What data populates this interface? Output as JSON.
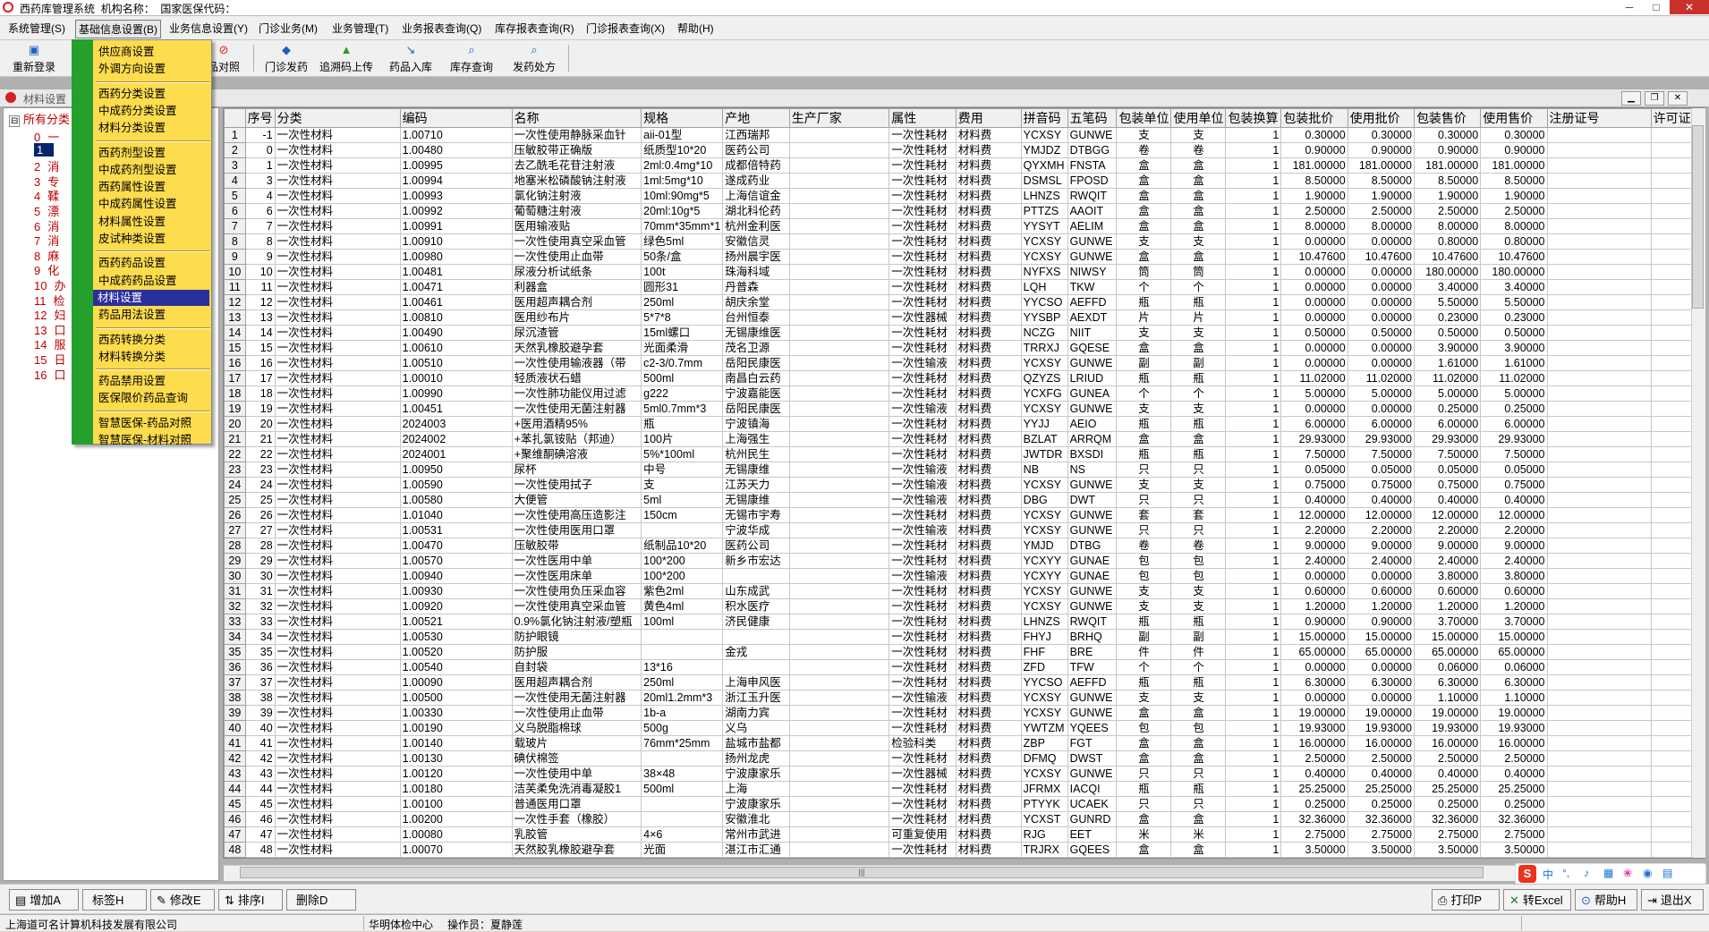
{
  "titlebar": {
    "app": "西药库管理系统",
    "org_label": "机构名称：",
    "code_label": "国家医保代码：",
    "min": "─",
    "max": "□",
    "close": "✕"
  },
  "menu": [
    "系统管理(S)",
    "基础信息设置(B)",
    "业务信息设置(Y)",
    "门诊业务(M)",
    "业务管理(T)",
    "业务报表查询(Q)",
    "库存报表查询(R)",
    "门诊报表查询(X)",
    "帮助(H)"
  ],
  "toolbar": {
    "relogin": "重新登录",
    "compare": "品对照",
    "outpatient": "门诊发药",
    "trace": "追溯码上传",
    "drugin": "药品入库",
    "stockq": "库存查询",
    "prescribe": "发药处方"
  },
  "child": {
    "title": "材料设置"
  },
  "dropdown": [
    {
      "label": "供应商设置"
    },
    {
      "label": "外调方向设置"
    },
    {
      "label": "西药分类设置"
    },
    {
      "label": "中成药分类设置"
    },
    {
      "label": "材料分类设置"
    },
    {
      "label": "西药剂型设置"
    },
    {
      "label": "中成药剂型设置"
    },
    {
      "label": "西药属性设置"
    },
    {
      "label": "中成药属性设置"
    },
    {
      "label": "材料属性设置"
    },
    {
      "label": "皮试种类设置"
    },
    {
      "label": "西药药品设置"
    },
    {
      "label": "中成药药品设置"
    },
    {
      "label": "材料设置"
    },
    {
      "label": "药品用法设置"
    },
    {
      "label": "西药转换分类"
    },
    {
      "label": "材料转换分类"
    },
    {
      "label": "药品禁用设置"
    },
    {
      "label": "医保限价药品查询"
    },
    {
      "label": "智慧医保-药品对照"
    },
    {
      "label": "智慧医保-材料对照"
    }
  ],
  "tree": {
    "root": "所有分类",
    "nodes": [
      "0",
      "1",
      "2",
      "3",
      "4",
      "5",
      "6",
      "7",
      "8",
      "9",
      "10",
      "11",
      "12",
      "13",
      "14",
      "15",
      "16"
    ],
    "glyphs": {
      "0": "一",
      "2": "消",
      "3": "专",
      "4": "鞣",
      "5": "漂",
      "6": "消",
      "7": "消",
      "8": "麻",
      "9": "化",
      "10": "办",
      "11": "检",
      "12": "妇",
      "13": "口",
      "14": "服",
      "15": "日",
      "16": "口"
    }
  },
  "grid": {
    "columns": [
      "序号",
      "分类",
      "编码",
      "名称",
      "规格",
      "产地",
      "生产厂家",
      "属性",
      "费用",
      "拼音码",
      "五笔码",
      "包装单位",
      "使用单位",
      "包装换算",
      "包装批价",
      "使用批价",
      "包装售价",
      "使用售价",
      "注册证号",
      "许可证"
    ],
    "rows": [
      [
        "1",
        "-1",
        "一次性材料",
        "1.00710",
        "一次性使用静脉采血针",
        "aii-01型",
        "江西瑞邦",
        "",
        "一次性耗材",
        "材料费",
        "YCXSY",
        "GUNWE",
        "支",
        "支",
        "1",
        "0.30000",
        "0.30000",
        "0.30000",
        "0.30000"
      ],
      [
        "2",
        "0",
        "一次性材料",
        "1.00480",
        "压敏胶带正确版",
        "纸质型10*20",
        "医药公司",
        "",
        "一次性耗材",
        "材料费",
        "YMJDZ",
        "DTBGG",
        "卷",
        "卷",
        "1",
        "0.90000",
        "0.90000",
        "0.90000",
        "0.90000"
      ],
      [
        "3",
        "1",
        "一次性材料",
        "1.00995",
        "去乙酰毛花苷注射液",
        "2ml:0.4mg*10",
        "成都倍特药",
        "",
        "一次性耗材",
        "材料费",
        "QYXMH",
        "FNSTA",
        "盒",
        "盒",
        "1",
        "181.00000",
        "181.00000",
        "181.00000",
        "181.00000"
      ],
      [
        "4",
        "3",
        "一次性材料",
        "1.00994",
        "地塞米松磷酸钠注射液",
        "1ml:5mg*10",
        "遂成药业",
        "",
        "一次性耗材",
        "材料费",
        "DSMSL",
        "FPOSD",
        "盒",
        "盒",
        "1",
        "8.50000",
        "8.50000",
        "8.50000",
        "8.50000"
      ],
      [
        "5",
        "4",
        "一次性材料",
        "1.00993",
        "氯化钠注射液",
        "10ml:90mg*5",
        "上海信谊金",
        "",
        "一次性耗材",
        "材料费",
        "LHNZS",
        "RWQIT",
        "盒",
        "盒",
        "1",
        "1.90000",
        "1.90000",
        "1.90000",
        "1.90000"
      ],
      [
        "6",
        "6",
        "一次性材料",
        "1.00992",
        "葡萄糖注射液",
        "20ml:10g*5",
        "湖北科伦药",
        "",
        "一次性耗材",
        "材料费",
        "PTTZS",
        "AAOIT",
        "盒",
        "盒",
        "1",
        "2.50000",
        "2.50000",
        "2.50000",
        "2.50000"
      ],
      [
        "7",
        "7",
        "一次性材料",
        "1.00991",
        "医用输液贴",
        "70mm*35mm*1",
        "杭州金利医",
        "",
        "一次性耗材",
        "材料费",
        "YYSYT",
        "AELIM",
        "盒",
        "盒",
        "1",
        "8.00000",
        "8.00000",
        "8.00000",
        "8.00000"
      ],
      [
        "8",
        "8",
        "一次性材料",
        "1.00910",
        "一次性使用真空采血管",
        "绿色5ml",
        "安徽信灵",
        "",
        "一次性耗材",
        "材料费",
        "YCXSY",
        "GUNWE",
        "支",
        "支",
        "1",
        "0.00000",
        "0.00000",
        "0.80000",
        "0.80000"
      ],
      [
        "9",
        "9",
        "一次性材料",
        "1.00980",
        "一次性使用止血带",
        "50条/盒",
        "扬州晨宇医",
        "",
        "一次性耗材",
        "材料费",
        "YCXSY",
        "GUNWE",
        "盒",
        "盒",
        "1",
        "10.47600",
        "10.47600",
        "10.47600",
        "10.47600"
      ],
      [
        "10",
        "10",
        "一次性材料",
        "1.00481",
        "尿液分析试纸条",
        "100t",
        "珠海科域",
        "",
        "一次性耗材",
        "材料费",
        "NYFXS",
        "NIWSY",
        "筒",
        "筒",
        "1",
        "0.00000",
        "0.00000",
        "180.00000",
        "180.00000"
      ],
      [
        "11",
        "11",
        "一次性材料",
        "1.00471",
        "利器盒",
        "圆形31",
        "丹普森",
        "",
        "一次性耗材",
        "材料费",
        "LQH",
        "TKW",
        "个",
        "个",
        "1",
        "0.00000",
        "0.00000",
        "3.40000",
        "3.40000"
      ],
      [
        "12",
        "12",
        "一次性材料",
        "1.00461",
        "医用超声耦合剂",
        "250ml",
        "胡庆余堂",
        "",
        "一次性耗材",
        "材料费",
        "YYCSO",
        "AEFFD",
        "瓶",
        "瓶",
        "1",
        "0.00000",
        "0.00000",
        "5.50000",
        "5.50000"
      ],
      [
        "13",
        "13",
        "一次性材料",
        "1.00810",
        "医用纱布片",
        "5*7*8",
        "台州恒泰",
        "",
        "一次性器械",
        "材料费",
        "YYSBP",
        "AEXDT",
        "片",
        "片",
        "1",
        "0.00000",
        "0.00000",
        "0.23000",
        "0.23000"
      ],
      [
        "14",
        "14",
        "一次性材料",
        "1.00490",
        "尿沉渣管",
        "15ml螺口",
        "无锡康维医",
        "",
        "一次性耗材",
        "材料费",
        "NCZG",
        "NIIT",
        "支",
        "支",
        "1",
        "0.50000",
        "0.50000",
        "0.50000",
        "0.50000"
      ],
      [
        "15",
        "15",
        "一次性材料",
        "1.00610",
        "天然乳橡胶避孕套",
        "光面柔滑",
        "茂名卫源",
        "",
        "一次性耗材",
        "材料费",
        "TRRXJ",
        "GQESE",
        "盒",
        "盒",
        "1",
        "0.00000",
        "0.00000",
        "3.90000",
        "3.90000"
      ],
      [
        "16",
        "16",
        "一次性材料",
        "1.00510",
        "一次性使用输液器（带",
        "c2-3/0.7mm",
        "岳阳民康医",
        "",
        "一次性输液",
        "材料费",
        "YCXSY",
        "GUNWE",
        "副",
        "副",
        "1",
        "0.00000",
        "0.00000",
        "1.61000",
        "1.61000"
      ],
      [
        "17",
        "17",
        "一次性材料",
        "1.00010",
        "轻质液状石蜡",
        "500ml",
        "南昌白云药",
        "",
        "一次性耗材",
        "材料费",
        "QZYZS",
        "LRIUD",
        "瓶",
        "瓶",
        "1",
        "11.02000",
        "11.02000",
        "11.02000",
        "11.02000"
      ],
      [
        "18",
        "18",
        "一次性材料",
        "1.00990",
        "一次性肺功能仪用过滤",
        "g222",
        "宁波嘉能医",
        "",
        "一次性耗材",
        "材料费",
        "YCXFG",
        "GUNEA",
        "个",
        "个",
        "1",
        "5.00000",
        "5.00000",
        "5.00000",
        "5.00000"
      ],
      [
        "19",
        "19",
        "一次性材料",
        "1.00451",
        "一次性使用无菌注射器",
        "5ml0.7mm*3",
        "岳阳民康医",
        "",
        "一次性输液",
        "材料费",
        "YCXSY",
        "GUNWE",
        "支",
        "支",
        "1",
        "0.00000",
        "0.00000",
        "0.25000",
        "0.25000"
      ],
      [
        "20",
        "20",
        "一次性材料",
        "2024003",
        "+医用酒精95%",
        "瓶",
        "宁波镇海",
        "",
        "一次性耗材",
        "材料费",
        "YYJJ",
        "AEIO",
        "瓶",
        "瓶",
        "1",
        "6.00000",
        "6.00000",
        "6.00000",
        "6.00000"
      ],
      [
        "21",
        "21",
        "一次性材料",
        "2024002",
        "+苯扎氯铵贴（邦迪）",
        "100片",
        "上海强生",
        "",
        "一次性耗材",
        "材料费",
        "BZLAT",
        "ARRQM",
        "盒",
        "盒",
        "1",
        "29.93000",
        "29.93000",
        "29.93000",
        "29.93000"
      ],
      [
        "22",
        "22",
        "一次性材料",
        "2024001",
        "+聚维酮碘溶液",
        "5%*100ml",
        "杭州民生",
        "",
        "一次性耗材",
        "材料费",
        "JWTDR",
        "BXSDI",
        "瓶",
        "瓶",
        "1",
        "7.50000",
        "7.50000",
        "7.50000",
        "7.50000"
      ],
      [
        "23",
        "23",
        "一次性材料",
        "1.00950",
        "尿杯",
        "中号",
        "无锡康维",
        "",
        "一次性输液",
        "材料费",
        "NB",
        "NS",
        "只",
        "只",
        "1",
        "0.05000",
        "0.05000",
        "0.05000",
        "0.05000"
      ],
      [
        "24",
        "24",
        "一次性材料",
        "1.00590",
        "一次性使用拭子",
        "支",
        "江苏天力",
        "",
        "一次性输液",
        "材料费",
        "YCXSY",
        "GUNWE",
        "支",
        "支",
        "1",
        "0.75000",
        "0.75000",
        "0.75000",
        "0.75000"
      ],
      [
        "25",
        "25",
        "一次性材料",
        "1.00580",
        "大便管",
        "5ml",
        "无锡康维",
        "",
        "一次性输液",
        "材料费",
        "DBG",
        "DWT",
        "只",
        "只",
        "1",
        "0.40000",
        "0.40000",
        "0.40000",
        "0.40000"
      ],
      [
        "26",
        "26",
        "一次性材料",
        "1.01040",
        "一次性使用高压造影注",
        "150cm",
        "无锡市宇寿",
        "",
        "一次性耗材",
        "材料费",
        "YCXSY",
        "GUNWE",
        "套",
        "套",
        "1",
        "12.00000",
        "12.00000",
        "12.00000",
        "12.00000"
      ],
      [
        "27",
        "27",
        "一次性材料",
        "1.00531",
        "一次性使用医用口罩",
        "",
        "宁波华成",
        "",
        "一次性输液",
        "材料费",
        "YCXSY",
        "GUNWE",
        "只",
        "只",
        "1",
        "2.20000",
        "2.20000",
        "2.20000",
        "2.20000"
      ],
      [
        "28",
        "28",
        "一次性材料",
        "1.00470",
        "压敏胶带",
        "纸制品10*20",
        "医药公司",
        "",
        "一次性耗材",
        "材料费",
        "YMJD",
        "DTBG",
        "卷",
        "卷",
        "1",
        "9.00000",
        "9.00000",
        "9.00000",
        "9.00000"
      ],
      [
        "29",
        "29",
        "一次性材料",
        "1.00570",
        "一次性医用中单",
        "100*200",
        "新乡市宏达",
        "",
        "一次性耗材",
        "材料费",
        "YCXYY",
        "GUNAE",
        "包",
        "包",
        "1",
        "2.40000",
        "2.40000",
        "2.40000",
        "2.40000"
      ],
      [
        "30",
        "30",
        "一次性材料",
        "1.00940",
        "一次性医用床单",
        "100*200",
        "",
        "",
        "一次性输液",
        "材料费",
        "YCXYY",
        "GUNAE",
        "包",
        "包",
        "1",
        "0.00000",
        "0.00000",
        "3.80000",
        "3.80000"
      ],
      [
        "31",
        "31",
        "一次性材料",
        "1.00930",
        "一次性使用负压采血容",
        "紫色2ml",
        "山东成武",
        "",
        "一次性耗材",
        "材料费",
        "YCXSY",
        "GUNWE",
        "支",
        "支",
        "1",
        "0.60000",
        "0.60000",
        "0.60000",
        "0.60000"
      ],
      [
        "32",
        "32",
        "一次性材料",
        "1.00920",
        "一次性使用真空采血管",
        "黄色4ml",
        "积水医疗",
        "",
        "一次性耗材",
        "材料费",
        "YCXSY",
        "GUNWE",
        "支",
        "支",
        "1",
        "1.20000",
        "1.20000",
        "1.20000",
        "1.20000"
      ],
      [
        "33",
        "33",
        "一次性材料",
        "1.00521",
        "0.9%氯化钠注射液/塑瓶",
        "100ml",
        "济民健康",
        "",
        "一次性耗材",
        "材料费",
        "LHNZS",
        "RWQIT",
        "瓶",
        "瓶",
        "1",
        "0.90000",
        "0.90000",
        "3.70000",
        "3.70000"
      ],
      [
        "34",
        "34",
        "一次性材料",
        "1.00530",
        "防护眼镜",
        "",
        "",
        "",
        "一次性耗材",
        "材料费",
        "FHYJ",
        "BRHQ",
        "副",
        "副",
        "1",
        "15.00000",
        "15.00000",
        "15.00000",
        "15.00000"
      ],
      [
        "35",
        "35",
        "一次性材料",
        "1.00520",
        "防护服",
        "",
        "金戎",
        "",
        "一次性耗材",
        "材料费",
        "FHF",
        "BRE",
        "件",
        "件",
        "1",
        "65.00000",
        "65.00000",
        "65.00000",
        "65.00000"
      ],
      [
        "36",
        "36",
        "一次性材料",
        "1.00540",
        "自封袋",
        "13*16",
        "",
        "",
        "一次性耗材",
        "材料费",
        "ZFD",
        "TFW",
        "个",
        "个",
        "1",
        "0.00000",
        "0.00000",
        "0.06000",
        "0.06000"
      ],
      [
        "37",
        "37",
        "一次性材料",
        "1.00090",
        "医用超声耦合剂",
        "250ml",
        "上海申风医",
        "",
        "一次性耗材",
        "材料费",
        "YYCSO",
        "AEFFD",
        "瓶",
        "瓶",
        "1",
        "6.30000",
        "6.30000",
        "6.30000",
        "6.30000"
      ],
      [
        "38",
        "38",
        "一次性材料",
        "1.00500",
        "一次性使用无菌注射器",
        "20ml1.2mm*3",
        "浙江玉升医",
        "",
        "一次性输液",
        "材料费",
        "YCXSY",
        "GUNWE",
        "支",
        "支",
        "1",
        "0.00000",
        "0.00000",
        "1.10000",
        "1.10000"
      ],
      [
        "39",
        "39",
        "一次性材料",
        "1.00330",
        "一次性使用止血带",
        "1b-a",
        "湖南力宾",
        "",
        "一次性耗材",
        "材料费",
        "YCXSY",
        "GUNWE",
        "盒",
        "盒",
        "1",
        "19.00000",
        "19.00000",
        "19.00000",
        "19.00000"
      ],
      [
        "40",
        "40",
        "一次性材料",
        "1.00190",
        "义乌脱脂棉球",
        "500g",
        "义乌",
        "",
        "一次性耗材",
        "材料费",
        "YWTZM",
        "YQEES",
        "包",
        "包",
        "1",
        "19.93000",
        "19.93000",
        "19.93000",
        "19.93000"
      ],
      [
        "41",
        "41",
        "一次性材料",
        "1.00140",
        "载玻片",
        "76mm*25mm",
        "盐城市盐都",
        "",
        "检验科类",
        "材料费",
        "ZBP",
        "FGT",
        "盒",
        "盒",
        "1",
        "16.00000",
        "16.00000",
        "16.00000",
        "16.00000"
      ],
      [
        "42",
        "42",
        "一次性材料",
        "1.00130",
        "碘伏棉签",
        "",
        "扬州龙虎",
        "",
        "一次性耗材",
        "材料费",
        "DFMQ",
        "DWST",
        "盒",
        "盒",
        "1",
        "2.50000",
        "2.50000",
        "2.50000",
        "2.50000"
      ],
      [
        "43",
        "43",
        "一次性材料",
        "1.00120",
        "一次性使用中单",
        "38×48",
        "宁波康家乐",
        "",
        "一次性器械",
        "材料费",
        "YCXSY",
        "GUNWE",
        "只",
        "只",
        "1",
        "0.40000",
        "0.40000",
        "0.40000",
        "0.40000"
      ],
      [
        "44",
        "44",
        "一次性材料",
        "1.00180",
        "洁芙柔免洗消毒凝胶1",
        "500ml",
        "上海",
        "",
        "一次性耗材",
        "材料费",
        "JFRMX",
        "IACQI",
        "瓶",
        "瓶",
        "1",
        "25.25000",
        "25.25000",
        "25.25000",
        "25.25000"
      ],
      [
        "45",
        "45",
        "一次性材料",
        "1.00100",
        "普通医用口罩",
        "",
        "宁波康家乐",
        "",
        "一次性耗材",
        "材料费",
        "PTYYK",
        "UCAEK",
        "只",
        "只",
        "1",
        "0.25000",
        "0.25000",
        "0.25000",
        "0.25000"
      ],
      [
        "46",
        "46",
        "一次性材料",
        "1.00200",
        "一次性手套（橡胶）",
        "",
        "安徽淮北",
        "",
        "一次性耗材",
        "材料费",
        "YCXST",
        "GUNRD",
        "盒",
        "盒",
        "1",
        "32.36000",
        "32.36000",
        "32.36000",
        "32.36000"
      ],
      [
        "47",
        "47",
        "一次性材料",
        "1.00080",
        "乳胶管",
        "4×6",
        "常州市武进",
        "",
        "可重复使用",
        "材料费",
        "RJG",
        "EET",
        "米",
        "米",
        "1",
        "2.75000",
        "2.75000",
        "2.75000",
        "2.75000"
      ],
      [
        "48",
        "48",
        "一次性材料",
        "1.00070",
        "天然胶乳橡胶避孕套",
        "光面",
        "湛江市汇通",
        "",
        "一次性耗材",
        "材料费",
        "TRJRX",
        "GQEES",
        "盒",
        "盒",
        "1",
        "3.50000",
        "3.50000",
        "3.50000",
        "3.50000"
      ]
    ]
  },
  "bottom": {
    "add": "增加A",
    "label": "标签H",
    "edit": "修改E",
    "sort": "排序I",
    "delete": "删除D",
    "print": "打印P",
    "excel": "转Excel",
    "help": "帮助H",
    "exit": "退出X"
  },
  "status": {
    "company": "上海道可名计算机科技发展有限公司",
    "center": "华明体检中心",
    "operator_label": "操作员：",
    "operator": "夏静莲"
  },
  "ime": {
    "logo": "S",
    "lang": "中"
  }
}
